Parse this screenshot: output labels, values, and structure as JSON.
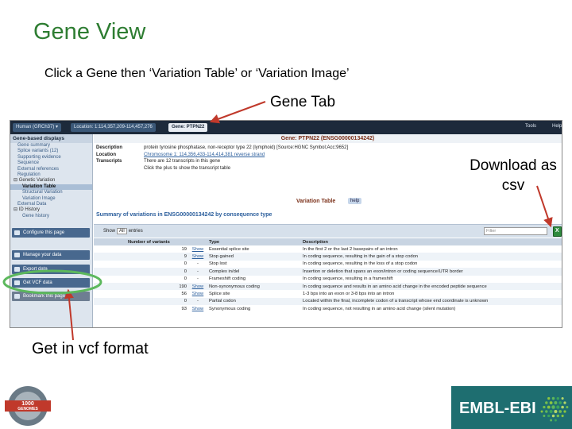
{
  "slide": {
    "title": "Gene View",
    "subtitle": "Click a Gene then ‘Variation Table’ or ‘Variation Image’",
    "callout_gene_tab": "Gene Tab",
    "callout_download": "Download as csv",
    "callout_vcf": "Get in vcf format",
    "accent_color": "#2e7d32",
    "highlight_color": "#5cb85c",
    "arrow_color": "#c0392b"
  },
  "browser": {
    "tabs": [
      "Human (GRCh37) ▾",
      "Location: 1:114,357,209-114,457,276",
      "Gene: PTPN22"
    ],
    "active_tab": "Gene: PTPN22",
    "right_links": [
      "Tools",
      "Help"
    ]
  },
  "sidebar": {
    "header": "Gene-based displays",
    "items": [
      {
        "label": "Gene summary",
        "level": "item"
      },
      {
        "label": "Splice variants (12)",
        "level": "item"
      },
      {
        "label": "Supporting evidence",
        "level": "item"
      },
      {
        "label": "Sequence",
        "level": "item"
      },
      {
        "label": "External references",
        "level": "item"
      },
      {
        "label": "Regulation",
        "level": "item"
      },
      {
        "label": "⊟ Genetic Variation",
        "level": "group"
      },
      {
        "label": "Variation Table",
        "level": "sub",
        "selected": true
      },
      {
        "label": "Structural Variation",
        "level": "sub"
      },
      {
        "label": "Variation Image",
        "level": "sub"
      },
      {
        "label": "External Data",
        "level": "item"
      },
      {
        "label": "⊟ ID History",
        "level": "group"
      },
      {
        "label": "Gene history",
        "level": "sub"
      }
    ],
    "buttons": [
      "Configure this page",
      "Manage your data",
      "Export data",
      "Get VCF data",
      "Bookmark this page"
    ]
  },
  "gene": {
    "heading": "Gene: PTPN22 (ENSG00000134242)",
    "description_label": "Description",
    "description": "protein tyrosine phosphatase, non-receptor type 22 (lymphoid) [Source:HGNC Symbol;Acc:9652]",
    "location_label": "Location",
    "location": "Chromosome 1: 114,356,433-114,414,381 reverse strand",
    "transcripts_label": "Transcripts",
    "transcripts_line1": "There are 12 transcripts in this gene",
    "transcripts_line2": "Click the plus to show the transcript table"
  },
  "variation_table": {
    "title": "Variation Table",
    "help": "help",
    "summary": "Summary of variations in ENSG00000134242 by consequence type",
    "show_prefix": "Show",
    "show_value": "All",
    "show_suffix": "entries",
    "filter_placeholder": "Filter",
    "columns": [
      "Number of variants",
      "",
      "Type",
      "Description"
    ],
    "rows": [
      {
        "count": "19",
        "show": "Show",
        "type": "Essential splice site",
        "desc": "In the first 2 or the last 2 basepairs of an intron"
      },
      {
        "count": "9",
        "show": "Show",
        "type": "Stop gained",
        "desc": "In coding sequence, resulting in the gain of a stop codon"
      },
      {
        "count": "0",
        "show": "-",
        "type": "Stop lost",
        "desc": "In coding sequence, resulting in the loss of a stop codon"
      },
      {
        "count": "0",
        "show": "-",
        "type": "Complex in/del",
        "desc": "Insertion or deletion that spans an exon/intron or coding sequence/UTR border"
      },
      {
        "count": "0",
        "show": "-",
        "type": "Frameshift coding",
        "desc": "In coding sequence, resulting in a frameshift"
      },
      {
        "count": "190",
        "show": "Show",
        "type": "Non-synonymous coding",
        "desc": "In coding sequence and results in an amino acid change in the encoded peptide sequence"
      },
      {
        "count": "56",
        "show": "Show",
        "type": "Splice site",
        "desc": "1-3 bps into an exon or 3-8 bps into an intron"
      },
      {
        "count": "0",
        "show": "-",
        "type": "Partial codon",
        "desc": "Located within the final, incomplete codon of a transcript whose end coordinate is unknown"
      },
      {
        "count": "93",
        "show": "Show",
        "type": "Synonymous coding",
        "desc": "In coding sequence, not resulting in an amino acid change (silent mutation)"
      }
    ]
  },
  "logos": {
    "ebi": "EMBL-EBI",
    "genomes_line1": "1000",
    "genomes_line2": "GENOMES"
  }
}
